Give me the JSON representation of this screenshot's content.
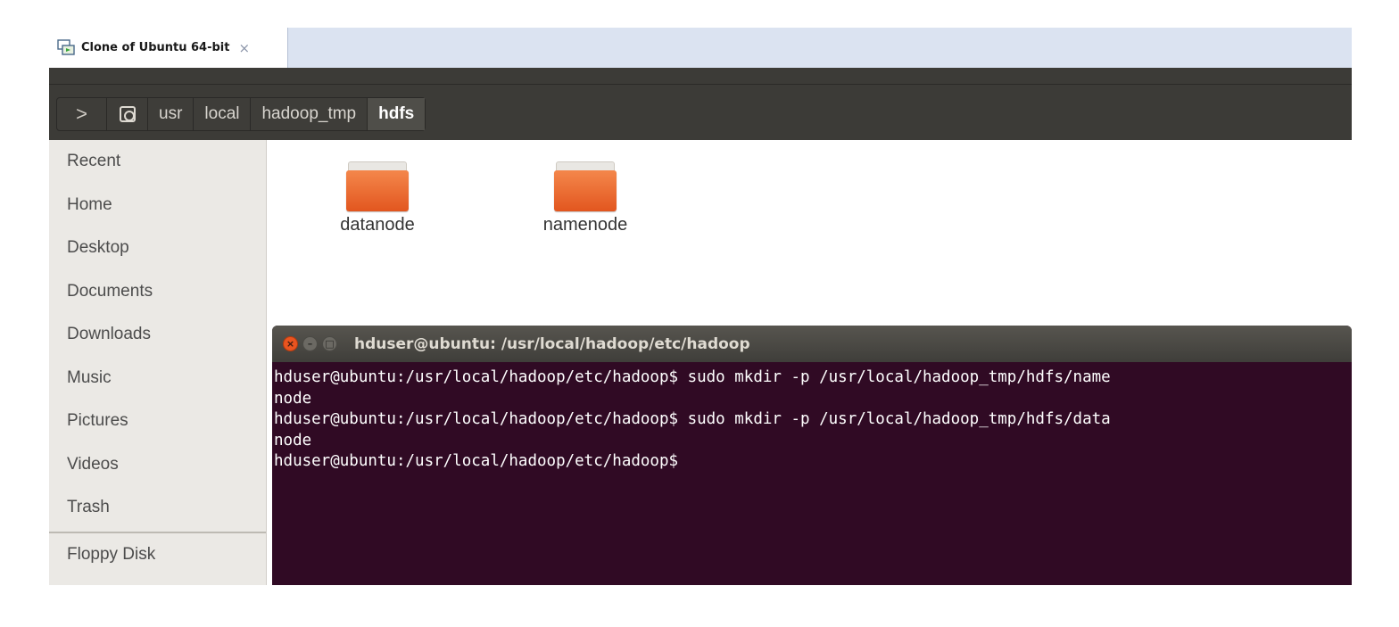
{
  "vm_tab": {
    "title": "Clone of Ubuntu 64-bit",
    "close_glyph": "×"
  },
  "pathbar": {
    "back_glyph": ">",
    "segments": [
      "usr",
      "local",
      "hadoop_tmp",
      "hdfs"
    ]
  },
  "sidebar": {
    "items": [
      "Recent",
      "Home",
      "Desktop",
      "Documents",
      "Downloads",
      "Music",
      "Pictures",
      "Videos",
      "Trash"
    ],
    "devices": [
      "Floppy Disk"
    ]
  },
  "files": [
    {
      "name": "datanode",
      "icon": "folder-icon"
    },
    {
      "name": "namenode",
      "icon": "folder-icon"
    }
  ],
  "terminal": {
    "title": "hduser@ubuntu: /usr/local/hadoop/etc/hadoop",
    "lines": [
      "hduser@ubuntu:/usr/local/hadoop/etc/hadoop$ sudo mkdir -p /usr/local/hadoop_tmp/hdfs/name",
      "node",
      "hduser@ubuntu:/usr/local/hadoop/etc/hadoop$ sudo mkdir -p /usr/local/hadoop_tmp/hdfs/data",
      "node",
      "hduser@ubuntu:/usr/local/hadoop/etc/hadoop$"
    ]
  },
  "colors": {
    "terminal_bg": "#300a24",
    "folder_orange": "#e95420",
    "toolbar_dark": "#3c3b37"
  }
}
